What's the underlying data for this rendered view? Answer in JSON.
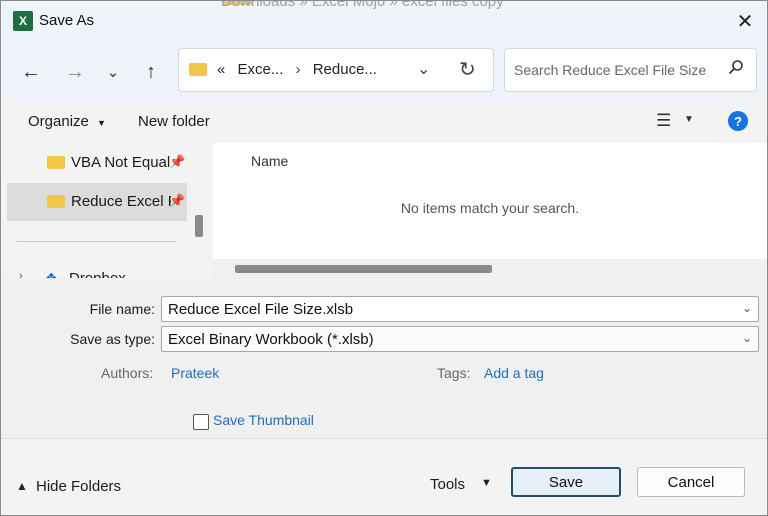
{
  "window": {
    "title": "Save As",
    "app_icon_letter": "X",
    "background_path": "Downloads » Excel Mojo » excel files copy"
  },
  "nav": {
    "address": {
      "prefix": "«",
      "segments": [
        "Exce...",
        "Reduce..."
      ],
      "separator": "›"
    },
    "search": {
      "placeholder": "Search Reduce Excel File Size"
    }
  },
  "toolbar": {
    "organize_label": "Organize",
    "new_folder_label": "New folder"
  },
  "sidebar": {
    "items": [
      {
        "label": "VBA Not Equal",
        "pinned": true,
        "selected": false
      },
      {
        "label": "Reduce Excel File Size",
        "pinned": true,
        "selected": true
      }
    ],
    "partial_item": "Dropbox"
  },
  "content": {
    "column_name": "Name",
    "empty_message": "No items match your search."
  },
  "form": {
    "file_name_label": "File name:",
    "file_name_value": "Reduce Excel File Size.xlsb",
    "save_type_label": "Save as type:",
    "save_type_value": "Excel Binary Workbook (*.xlsb)",
    "authors_label": "Authors:",
    "authors_value": "Prateek",
    "tags_label": "Tags:",
    "tags_value": "Add a tag",
    "thumbnail_label": "Save Thumbnail",
    "thumbnail_checked": false
  },
  "footer": {
    "hide_folders_label": "Hide Folders",
    "tools_label": "Tools",
    "save_label": "Save",
    "cancel_label": "Cancel"
  },
  "colors": {
    "accent": "#1a6fc4",
    "folder": "#f3c746",
    "excel_green": "#1d6f42",
    "help_blue": "#1473e6"
  }
}
